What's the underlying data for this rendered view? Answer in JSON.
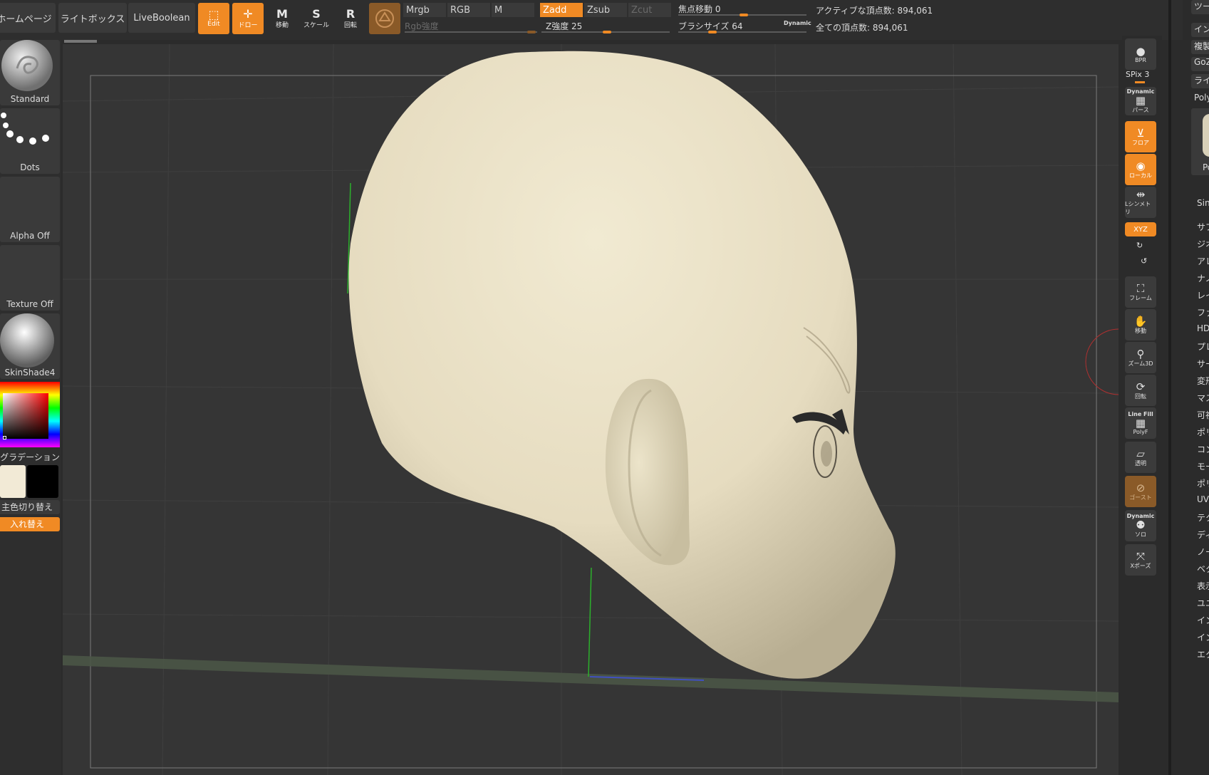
{
  "topbar": {
    "home_label": "ホームページ",
    "lightbox_label": "ライトボックス",
    "liveboolean_label": "LiveBoolean",
    "edit_label": "Edit",
    "draw_label": "ドロー",
    "move_label": "移動",
    "scale_label": "スケール",
    "rotate_label": "回転",
    "move_letter": "M",
    "scale_letter": "S",
    "rotate_letter": "R",
    "mrgb_label": "Mrgb",
    "rgb_label": "RGB",
    "m_label": "M",
    "zadd_label": "Zadd",
    "zsub_label": "Zsub",
    "zcut_label": "Zcut",
    "rgb_intensity_label": "Rgb強度",
    "z_intensity_label": "Z強度 25",
    "z_intensity_value": 25,
    "focal_shift_label": "焦点移動 0",
    "focal_shift_value": 0,
    "brush_size_label": "ブラシサイズ 64",
    "brush_size_value": 64,
    "dynamic_label": "Dynamic",
    "active_points_label": "アクティブな頂点数: 894,061",
    "total_points_label": "全ての頂点数: 894,061"
  },
  "leftshelf": {
    "brush_label": "Standard",
    "stroke_label": "Dots",
    "alpha_label": "Alpha Off",
    "texture_label": "Texture Off",
    "material_label": "SkinShade4",
    "gradient_label": "グラデーション",
    "switch_color_label": "主色切り替え",
    "swap_label": "入れ替え",
    "main_color": "#f2ead6",
    "secondary_color": "#000000"
  },
  "righttools": {
    "bpr_label": "BPR",
    "spix_label": "SPix 3",
    "persp_dynamic_label": "Dynamic",
    "persp_label": "パース",
    "floor_label": "フロア",
    "local_label": "ローカル",
    "symmetry_label": "Lシンメトリ",
    "xyz_label": "XYZ",
    "frame_label": "フレーム",
    "move_label": "移動",
    "zoom_label": "ズーム3D",
    "rotate_label": "回転",
    "linefill_label": "Line Fill",
    "polyf_label": "PolyF",
    "transp_label": "透明",
    "ghost_label": "ゴースト",
    "solo_dynamic_label": "Dynamic",
    "solo_label": "ソロ",
    "xpose_label": "Xポーズ"
  },
  "rightmenu": {
    "boxes": [
      "ツー",
      "イン",
      "複製",
      "GoZ",
      "ライ",
      "Poly"
    ],
    "thumb_label": "Po",
    "thumb_label2": "Sin",
    "items": [
      "サブ",
      "ジオ",
      "アレ",
      "ナノ",
      "レイ",
      "ファ",
      "HD",
      "プレ",
      "サー",
      "変形",
      "マス",
      "可視",
      "ポリ",
      "コン",
      "モー",
      "ポリ",
      "UV",
      "テク",
      "ディ",
      "ノー",
      "ベク",
      "表示",
      "ユニ",
      "イン",
      "イン",
      "エク"
    ]
  },
  "colors": {
    "accent": "#f08a24",
    "head_fill": "#e9e1c6",
    "canvas_bg": "#353535"
  }
}
